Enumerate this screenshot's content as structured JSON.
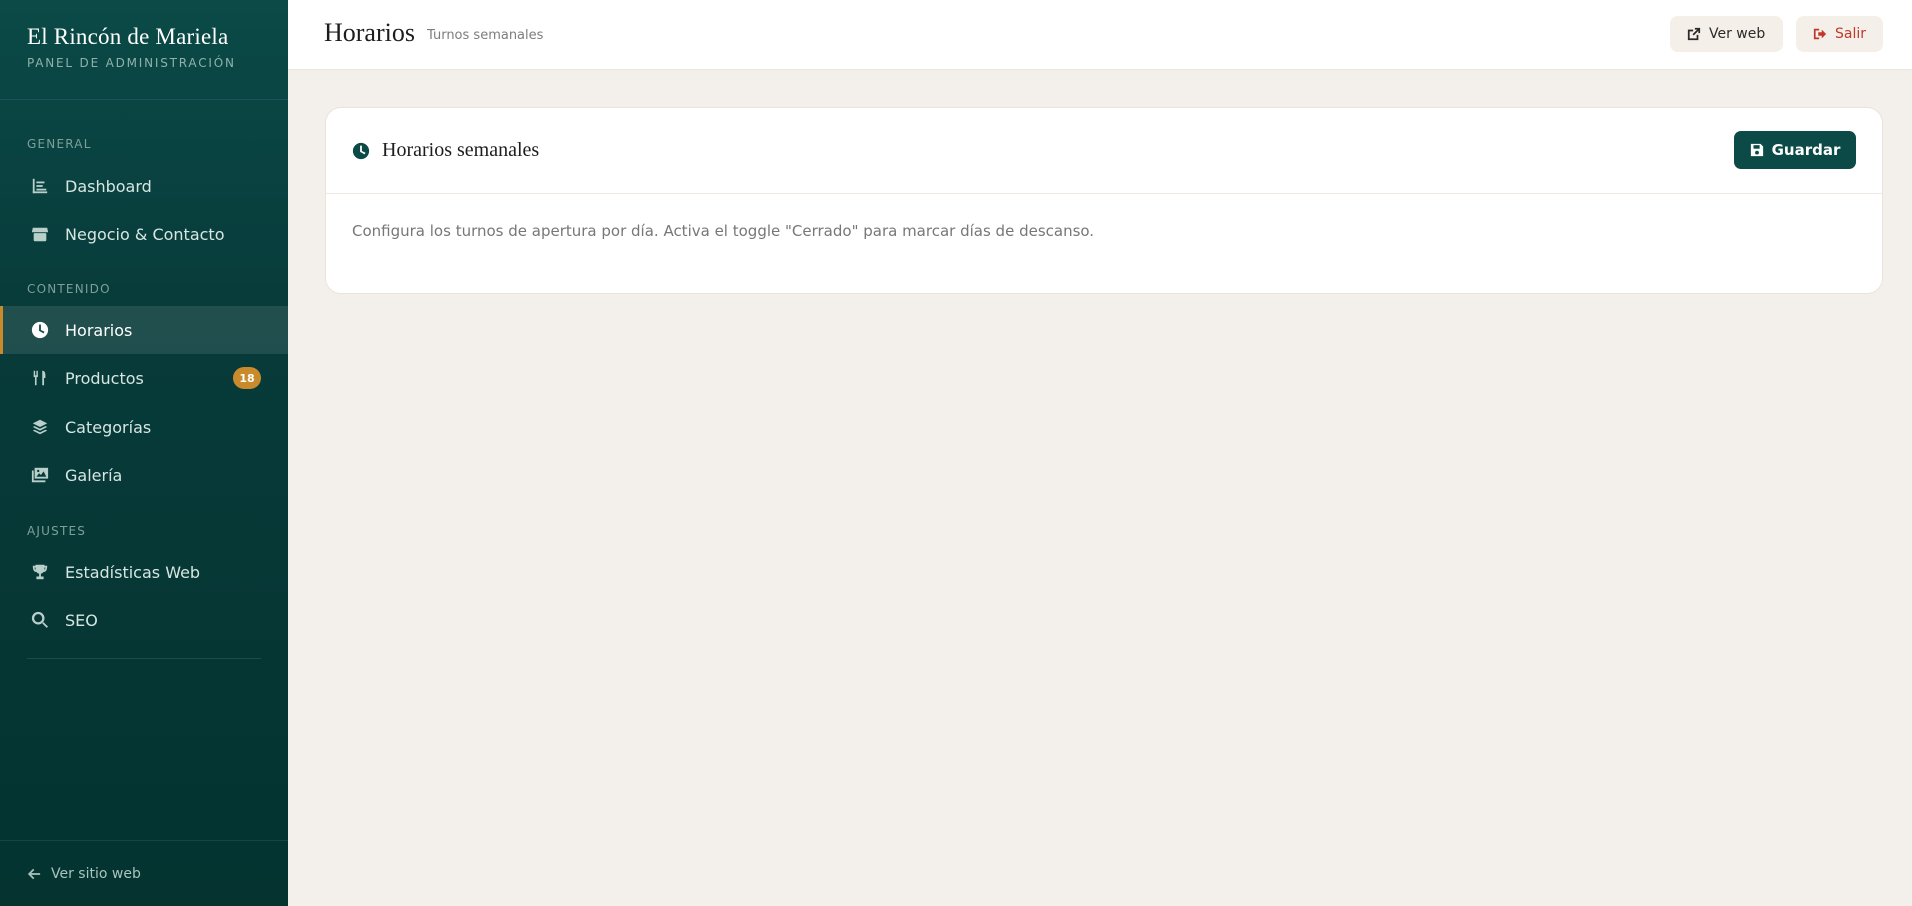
{
  "brand": {
    "title": "El Rincón de Mariela",
    "subtitle": "PANEL DE ADMINISTRACIÓN"
  },
  "sidebar": {
    "sections": [
      {
        "label": "GENERAL"
      },
      {
        "label": "CONTENIDO"
      },
      {
        "label": "AJUSTES"
      }
    ],
    "items": [
      {
        "label": "Dashboard",
        "icon": "chart-icon"
      },
      {
        "label": "Negocio & Contacto",
        "icon": "store-icon"
      },
      {
        "label": "Horarios",
        "icon": "clock-icon",
        "active": true
      },
      {
        "label": "Productos",
        "icon": "utensils-icon",
        "badge": "18"
      },
      {
        "label": "Categorías",
        "icon": "layers-icon"
      },
      {
        "label": "Galería",
        "icon": "images-icon"
      },
      {
        "label": "Estadísticas Web",
        "icon": "trophy-icon"
      },
      {
        "label": "SEO",
        "icon": "search-icon"
      }
    ],
    "footer_link": "Ver sitio web"
  },
  "header": {
    "title": "Horarios",
    "subtitle": "Turnos semanales",
    "view_site": "Ver web",
    "logout": "Salir"
  },
  "card": {
    "title": "Horarios semanales",
    "save_label": "Guardar",
    "description": "Configura los turnos de apertura por día. Activa el toggle \"Cerrado\" para marcar días de descanso."
  },
  "colors": {
    "sidebar": "#073b3a",
    "accent": "#c98a2b",
    "primary": "#0b4a47",
    "danger": "#c0392b",
    "background": "#f3efea"
  }
}
